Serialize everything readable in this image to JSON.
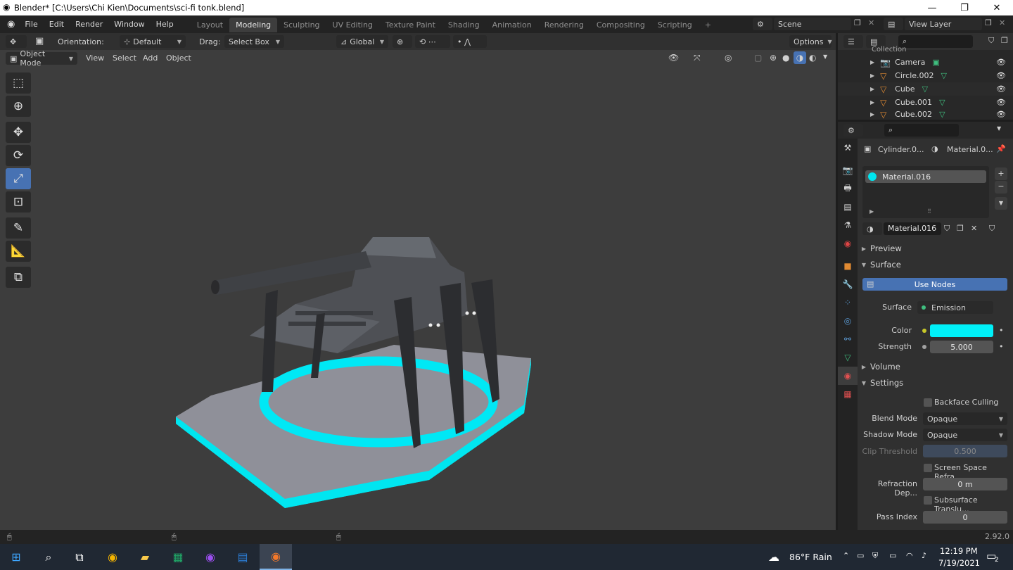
{
  "window": {
    "title": "Blender* [C:\\Users\\Chi Kien\\Documents\\sci-fi tonk.blend]"
  },
  "menu": [
    "File",
    "Edit",
    "Render",
    "Window",
    "Help"
  ],
  "workspaces": [
    "Layout",
    "Modeling",
    "Sculpting",
    "UV Editing",
    "Texture Paint",
    "Shading",
    "Animation",
    "Rendering",
    "Compositing",
    "Scripting"
  ],
  "active_workspace": "Modeling",
  "scene": {
    "label": "Scene",
    "view_layer": "View Layer"
  },
  "header": {
    "orientation_label": "Orientation:",
    "orientation_value": "Default",
    "drag_label": "Drag:",
    "drag_value": "Select Box",
    "transform": "Global",
    "options": "Options"
  },
  "header2": {
    "mode": "Object Mode",
    "items": [
      "View",
      "Select",
      "Add",
      "Object"
    ]
  },
  "outliner": {
    "collection": "Collection",
    "items": [
      "Camera",
      "Circle.002",
      "Cube",
      "Cube.001",
      "Cube.002"
    ]
  },
  "properties": {
    "object": "Cylinder.0...",
    "material_tab": "Material.0...",
    "slot": "Material.016",
    "material_name": "Material.016",
    "sections": {
      "preview": "Preview",
      "surface": "Surface",
      "volume": "Volume",
      "settings": "Settings"
    },
    "use_nodes": "Use Nodes",
    "surface_label": "Surface",
    "surface_value": "Emission",
    "color_label": "Color",
    "color_value": "#00ffff",
    "strength_label": "Strength",
    "strength_value": "5.000",
    "backface": "Backface Culling",
    "blend_label": "Blend Mode",
    "blend_value": "Opaque",
    "shadow_label": "Shadow Mode",
    "shadow_value": "Opaque",
    "clip_label": "Clip Threshold",
    "clip_value": "0.500",
    "ssr": "Screen Space Refra...",
    "refr_label": "Refraction Dep...",
    "refr_value": "0 m",
    "subsurface": "Subsurface Translu...",
    "pass_label": "Pass Index",
    "pass_value": "0"
  },
  "status": {
    "version": "2.92.0"
  },
  "taskbar": {
    "weather": "86°F Rain",
    "time": "12:19 PM",
    "date": "7/19/2021",
    "notifications": "2"
  }
}
